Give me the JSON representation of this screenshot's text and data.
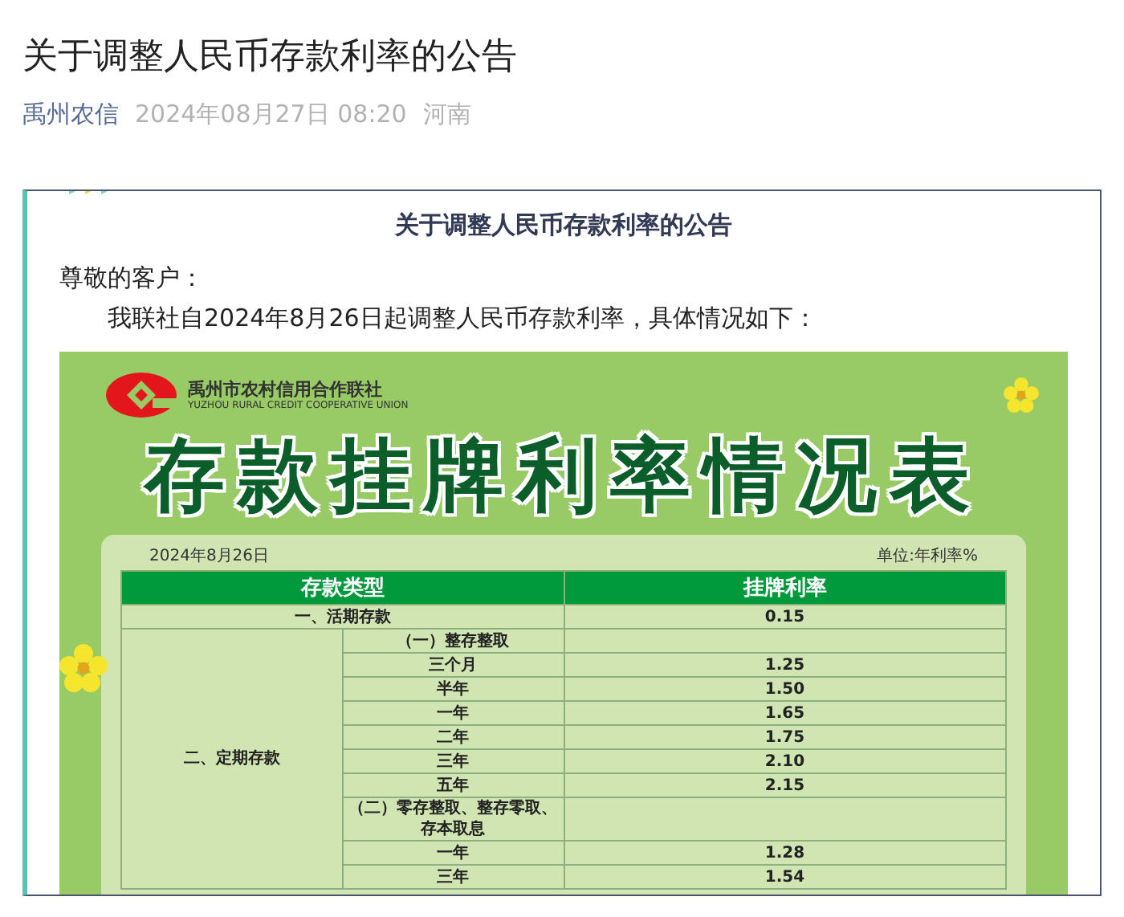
{
  "article": {
    "title": "关于调整人民币存款利率的公告",
    "source": "禹州农信",
    "date": "2024年08月27日 08:20",
    "region": "河南"
  },
  "notice": {
    "heading": "关于调整人民币存款利率的公告",
    "greeting": "尊敬的客户：",
    "intro": "我联社自2024年8月26日起调整人民币存款利率，具体情况如下："
  },
  "poster": {
    "org_name": "禹州市农村信用合作联社",
    "org_name_en": "YUZHOU RURAL CREDIT COOPERATIVE  UNION",
    "title": "存款挂牌利率情况表",
    "date": "2024年8月26日",
    "unit": "单位:年利率%",
    "table": {
      "columns": [
        "存款类型",
        "挂牌利率"
      ],
      "rows": [
        {
          "kind": "single",
          "label": "一、活期存款",
          "rate": "0.15"
        },
        {
          "kind": "group",
          "label": "二、定期存款",
          "items": [
            {
              "kind": "subheading",
              "label": "（一）整存整取"
            },
            {
              "kind": "term",
              "label": "三个月",
              "rate": "1.25"
            },
            {
              "kind": "term",
              "label": "半年",
              "rate": "1.50"
            },
            {
              "kind": "term",
              "label": "一年",
              "rate": "1.65"
            },
            {
              "kind": "term",
              "label": "二年",
              "rate": "1.75"
            },
            {
              "kind": "term",
              "label": "三年",
              "rate": "2.10"
            },
            {
              "kind": "term",
              "label": "五年",
              "rate": "2.15"
            },
            {
              "kind": "subheading",
              "label": "（二）零存整取、整存零取、存本取息"
            },
            {
              "kind": "term",
              "label": "一年",
              "rate": "1.28"
            },
            {
              "kind": "term",
              "label": "三年",
              "rate": "1.54"
            }
          ]
        }
      ]
    }
  }
}
